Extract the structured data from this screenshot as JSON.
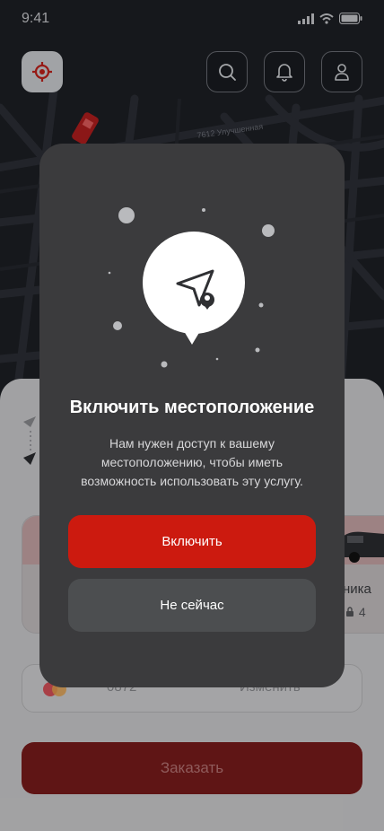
{
  "status_bar": {
    "time": "9:41"
  },
  "map": {
    "street_label": "7612 Улучшенная"
  },
  "header": {
    "locate_icon": "target-icon",
    "search_icon": "search-icon",
    "bell_icon": "bell-icon",
    "profile_icon": "user-icon"
  },
  "sheet": {
    "car_name": "ника",
    "car_seats": "4",
    "payment": {
      "card_last4": "0872",
      "change_label": "Изменить"
    },
    "order_label": "Заказать"
  },
  "modal": {
    "title": "Включить местоположение",
    "body": "Нам нужен доступ к вашему местоположению, чтобы иметь возможность использовать эту услугу.",
    "enable_label": "Включить",
    "later_label": "Не сейчас"
  },
  "colors": {
    "accent": "#cc1a0f",
    "modal_bg": "#3b3b3d",
    "secondary_btn": "#4c4e50"
  }
}
